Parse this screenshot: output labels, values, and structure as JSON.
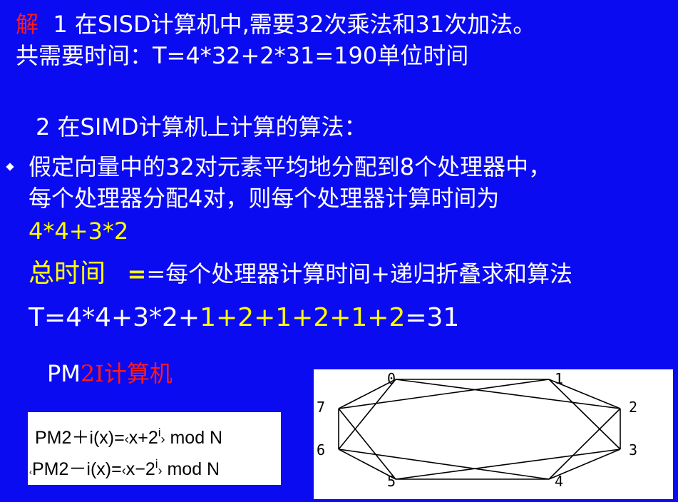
{
  "slide": {
    "line1": {
      "prefix": "解",
      "text": "1 在SISD计算机中,需要32次乘法和31次加法。"
    },
    "line2": "共需要时间：T=4*32+2*31=190单位时间",
    "line3": "2 在SIMD计算机上计算的算法：",
    "bullet_line1": "假定向量中的32对元素平均地分配到8个处理器中，",
    "bullet_line2": "每个处理器分配4对，则每个处理器计算时间为",
    "bullet_line3": "4*4+3*2",
    "total": {
      "label": "总时间",
      "text": "=每个处理器计算时间+递归折叠求和算法"
    },
    "equation": {
      "part1": "T=4*4+3*2+",
      "part2": "1+2+1+2+1+2",
      "part3": "=31"
    },
    "pm2i": {
      "prefix": "PM",
      "red": "2I计算机"
    }
  },
  "formulas": {
    "plus": {
      "lhs": "PM2＋i(x)=",
      "lparen": "‹",
      "body": "x+2",
      "sup": "i",
      "rparen": "›",
      "mod": "mod N"
    },
    "minus": {
      "lead": "‹",
      "lhs": "PM2－i(x)=",
      "lparen": "‹",
      "body": "x−2",
      "sup": "i",
      "rparen": "›",
      "mod": "mod N"
    }
  },
  "diagram": {
    "nodes": [
      "0",
      "1",
      "2",
      "3",
      "4",
      "5",
      "6",
      "7"
    ]
  },
  "colors": {
    "background": "#0b0bf2",
    "text": "#ffffff",
    "highlight_yellow": "#ffff00",
    "highlight_red": "#ff1a1a"
  }
}
